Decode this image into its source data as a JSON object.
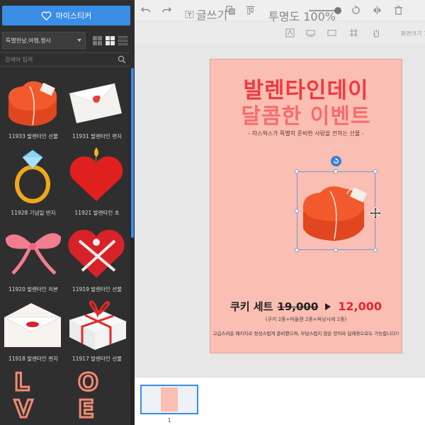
{
  "sidebar": {
    "my_sticker_label": "마이스티커",
    "category_selected": "특별한날,여행,행사",
    "search_placeholder": "검색어 입력",
    "items": [
      {
        "caption": "11933 발렌타인 선물"
      },
      {
        "caption": "11931 발렌타인 편지"
      },
      {
        "caption": "11928 기념일 반지"
      },
      {
        "caption": "11921 발렌타인 초"
      },
      {
        "caption": "11920 발렌타인 리본"
      },
      {
        "caption": "11919 발렌타인 선물"
      },
      {
        "caption": "11918 발렌타인 편지"
      },
      {
        "caption": "11917 발렌타인 선물"
      }
    ],
    "love_letters_left": [
      "L",
      "V"
    ],
    "love_letters_right": [
      "O",
      "E"
    ]
  },
  "toolbar": {
    "text_label": "글쓰기",
    "opacity_label": "투명도 100%",
    "opacity_value": 1.0,
    "zoom_label": "화면크기 73%"
  },
  "page": {
    "title_line1": "발렌타인데이",
    "title_line2": "달콤한 이벤트",
    "subtitle": "- 차스웍스가 특별히 준비한 사랑을 전하는 선물 -",
    "product_name": "쿠키 세트",
    "old_price": "19,000",
    "new_price": "12,000",
    "composition": "(쿠키 2종+마들렌 2종+파낭시에 2종)",
    "footer": "고급스러운 패키지로 정성스럽게 준비했으며, 부담스럽지 않은 양이라 답례용으로도 가능합니다!)"
  },
  "pages": {
    "thumbnail_number": "1"
  },
  "colors": {
    "accent": "#3a8ee6",
    "page_bg": "#fbbeb2",
    "title_red": "#ee3a40",
    "title_pink": "#f56d6f",
    "price_red": "#e8242c",
    "panel_bg": "#2f2f2f"
  }
}
